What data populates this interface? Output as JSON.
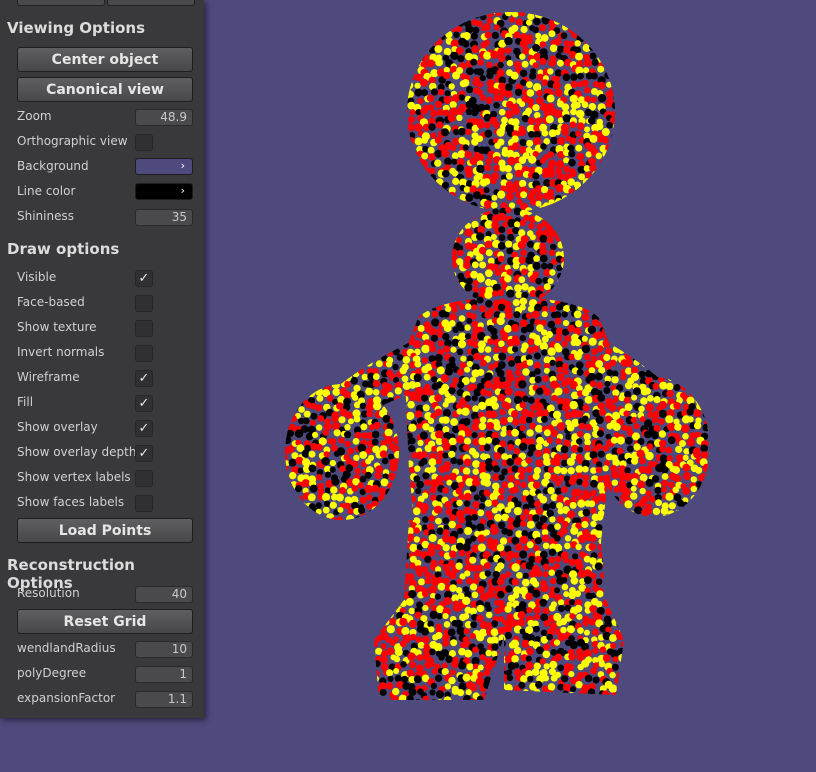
{
  "viewing_options": {
    "title": "Viewing Options",
    "center_object_label": "Center object",
    "canonical_view_label": "Canonical view",
    "zoom_label": "Zoom",
    "zoom_value": "48.9",
    "orthographic_label": "Orthographic view",
    "orthographic_checked": false,
    "background_label": "Background",
    "background_color": "#4e4a7e",
    "line_color_label": "Line color",
    "line_color": "#000000",
    "shininess_label": "Shininess",
    "shininess_value": "35",
    "color_arrow": "›"
  },
  "draw_options": {
    "title": "Draw options",
    "items": [
      {
        "label": "Visible",
        "checked": true
      },
      {
        "label": "Face-based",
        "checked": false
      },
      {
        "label": "Show texture",
        "checked": false
      },
      {
        "label": "Invert normals",
        "checked": false
      },
      {
        "label": "Wireframe",
        "checked": true
      },
      {
        "label": "Fill",
        "checked": true
      },
      {
        "label": "Show overlay",
        "checked": true
      },
      {
        "label": "Show overlay depth",
        "checked": true
      },
      {
        "label": "Show vertex labels",
        "checked": false
      },
      {
        "label": "Show faces labels",
        "checked": false
      }
    ],
    "load_points_label": "Load Points"
  },
  "reconstruction_options": {
    "title": "Reconstruction Options",
    "resolution_label": "Resolution",
    "resolution_value": "40",
    "reset_grid_label": "Reset Grid",
    "wendland_label": "wendlandRadius",
    "wendland_value": "10",
    "poly_label": "polyDegree",
    "poly_value": "1",
    "expansion_label": "expansionFactor",
    "expansion_value": "1.1"
  },
  "check_glyph": "✓",
  "point_colors": [
    "#ff0000",
    "#ffff00",
    "#000000"
  ]
}
